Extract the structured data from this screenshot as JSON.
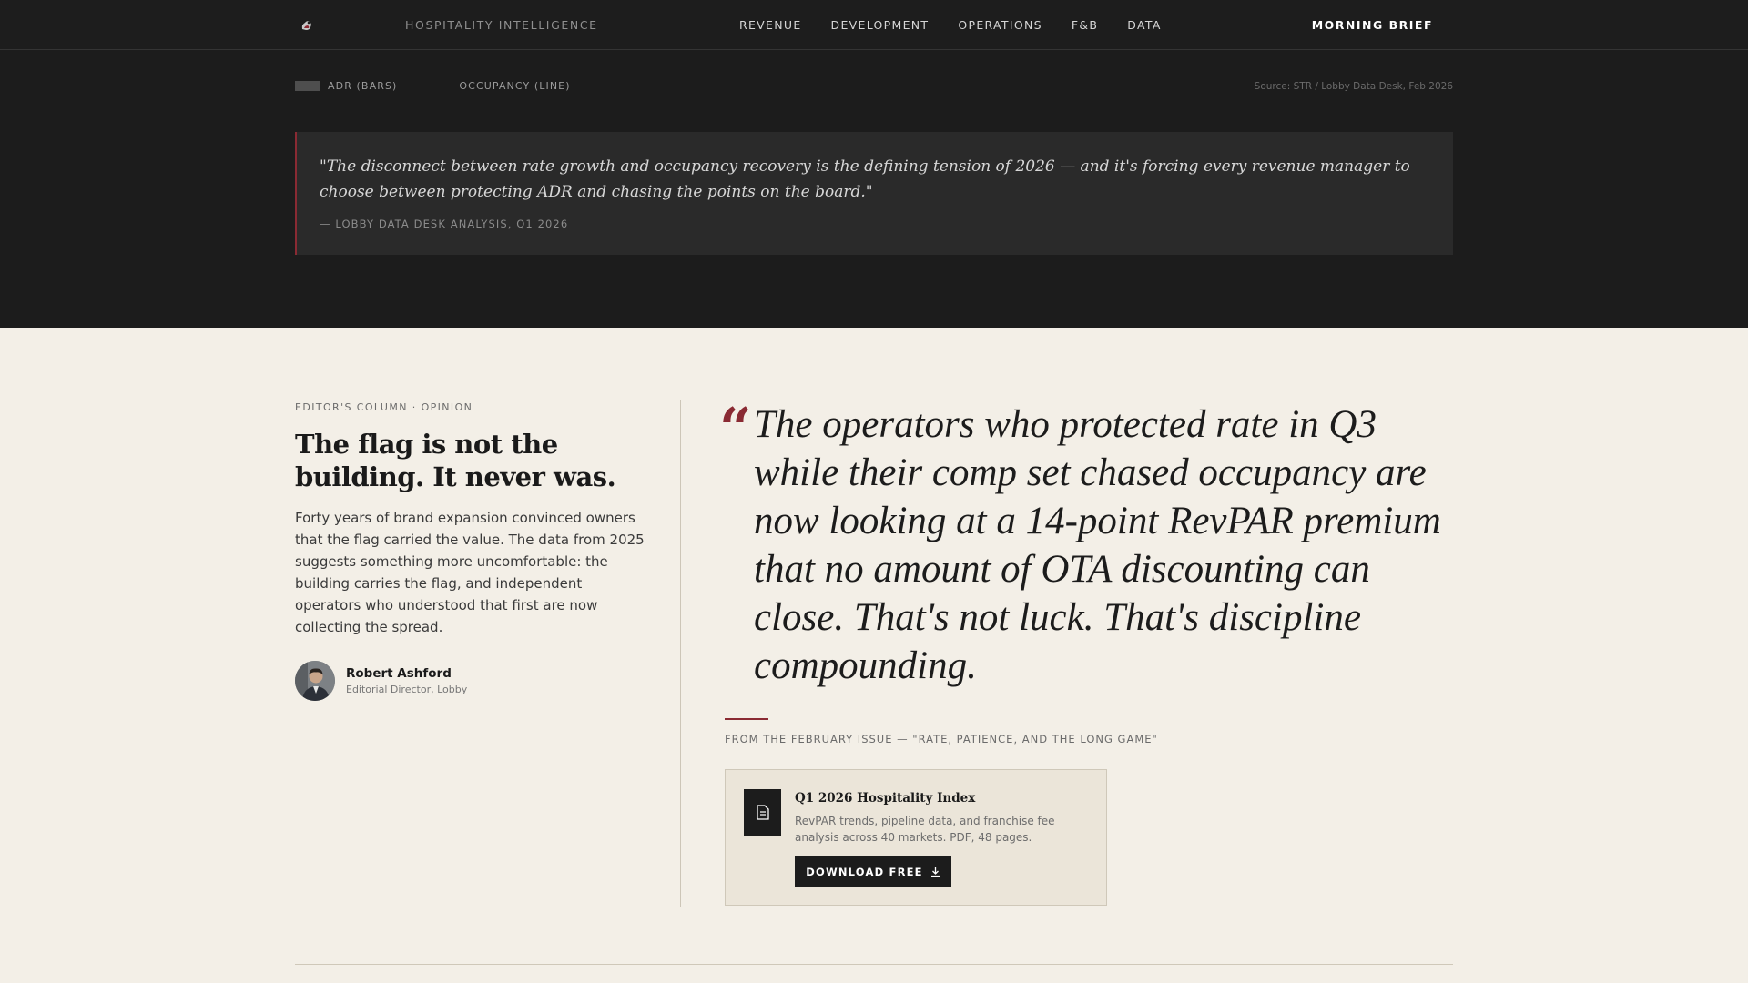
{
  "header": {
    "brand": "HOSPITALITY INTELLIGENCE",
    "nav": [
      "REVENUE",
      "DEVELOPMENT",
      "OPERATIONS",
      "F&B",
      "DATA"
    ],
    "cta": "MORNING BRIEF"
  },
  "chart_legend": {
    "bars_label": "ADR (BARS)",
    "line_label": "OCCUPANCY (LINE)",
    "source": "Source: STR / Lobby Data Desk, Feb 2026"
  },
  "quote": {
    "text": "\"The disconnect between rate growth and occupancy recovery is the defining tension of 2026 — and it's forcing every revenue manager to choose between protecting ADR and chasing the points on the board.\"",
    "attribution": "— LOBBY DATA DESK ANALYSIS, Q1 2026"
  },
  "editor": {
    "kicker": "EDITOR'S COLUMN · OPINION",
    "headline": "The flag is not the building. It never was.",
    "body": "Forty years of brand expansion convinced owners that the flag carried the value. The data from 2025 suggests something more uncomfortable: the building carries the flag, and independent operators who understood that first are now collecting the spread.",
    "author_name": "Robert Ashford",
    "author_role": "Editorial Director, Lobby"
  },
  "pull_quote": {
    "mark": "“",
    "text": "The operators who protected rate in Q3 while their comp set chased occupancy are now looking at a 14-point RevPAR premium that no amount of OTA discounting can close. That's not luck. That's discipline compounding.",
    "from_issue": "FROM THE FEBRUARY ISSUE — \"RATE, PATIENCE, AND THE LONG GAME\""
  },
  "download_card": {
    "title": "Q1 2026 Hospitality Index",
    "description": "RevPAR trends, pipeline data, and franchise fee analysis across 40 markets. PDF, 48 pages.",
    "button": "DOWNLOAD FREE"
  },
  "colors": {
    "accent": "#8a2a33",
    "dark_bg": "#1c1c1c",
    "paper_bg": "#f3efe7"
  }
}
